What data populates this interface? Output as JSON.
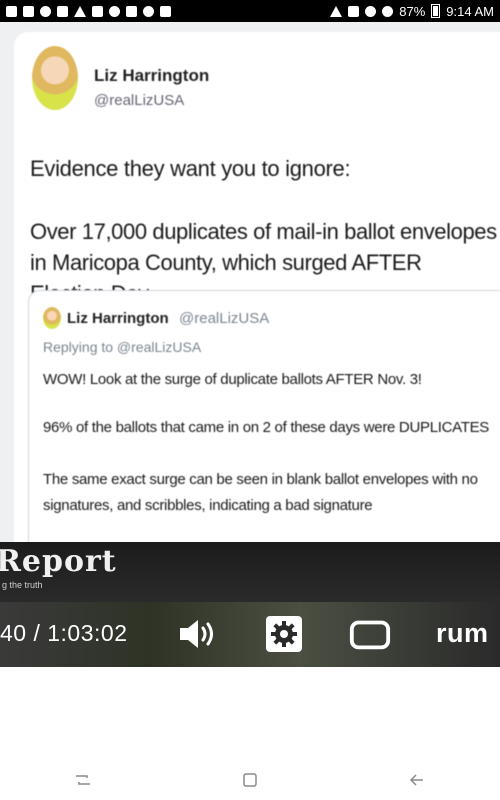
{
  "status_bar": {
    "battery": "87%",
    "time": "9:14 AM"
  },
  "tweet": {
    "author_name": "Liz Harrington",
    "author_handle": "@realLizUSA",
    "text_line1": "Evidence they want you to ignore:",
    "text_body": "Over 17,000 duplicates of mail-in ballot envelopes in Maricopa County, which surged AFTER Election Day"
  },
  "quoted_tweet": {
    "author_name": "Liz Harrington",
    "author_handle": "@realLizUSA",
    "replying_to": "Replying to @realLizUSA",
    "paragraph1": "WOW! Look at the surge of duplicate ballots AFTER Nov. 3!",
    "paragraph2": "96% of the ballots that came in on 2 of these days were DUPLICATES",
    "paragraph3": "The same exact surge can be seen in blank ballot envelopes with no signatures, and scribbles, indicating a bad signature"
  },
  "player": {
    "banner_title": "Report",
    "banner_subtitle": "g the truth",
    "time_display": "40 / 1:03:02",
    "logo_text": "rum"
  },
  "icons": {
    "volume": "volume-icon",
    "settings": "gear-icon",
    "fullscreen": "fullscreen-icon",
    "recents": "recents-icon",
    "home": "home-icon",
    "back": "back-icon"
  },
  "colors": {
    "status_bar_bg": "#000000",
    "tweet_text": "#1a1a1a",
    "handle_gray": "#7a8590",
    "player_bg": "#2a2a2a",
    "control_fg": "#ffffff"
  }
}
